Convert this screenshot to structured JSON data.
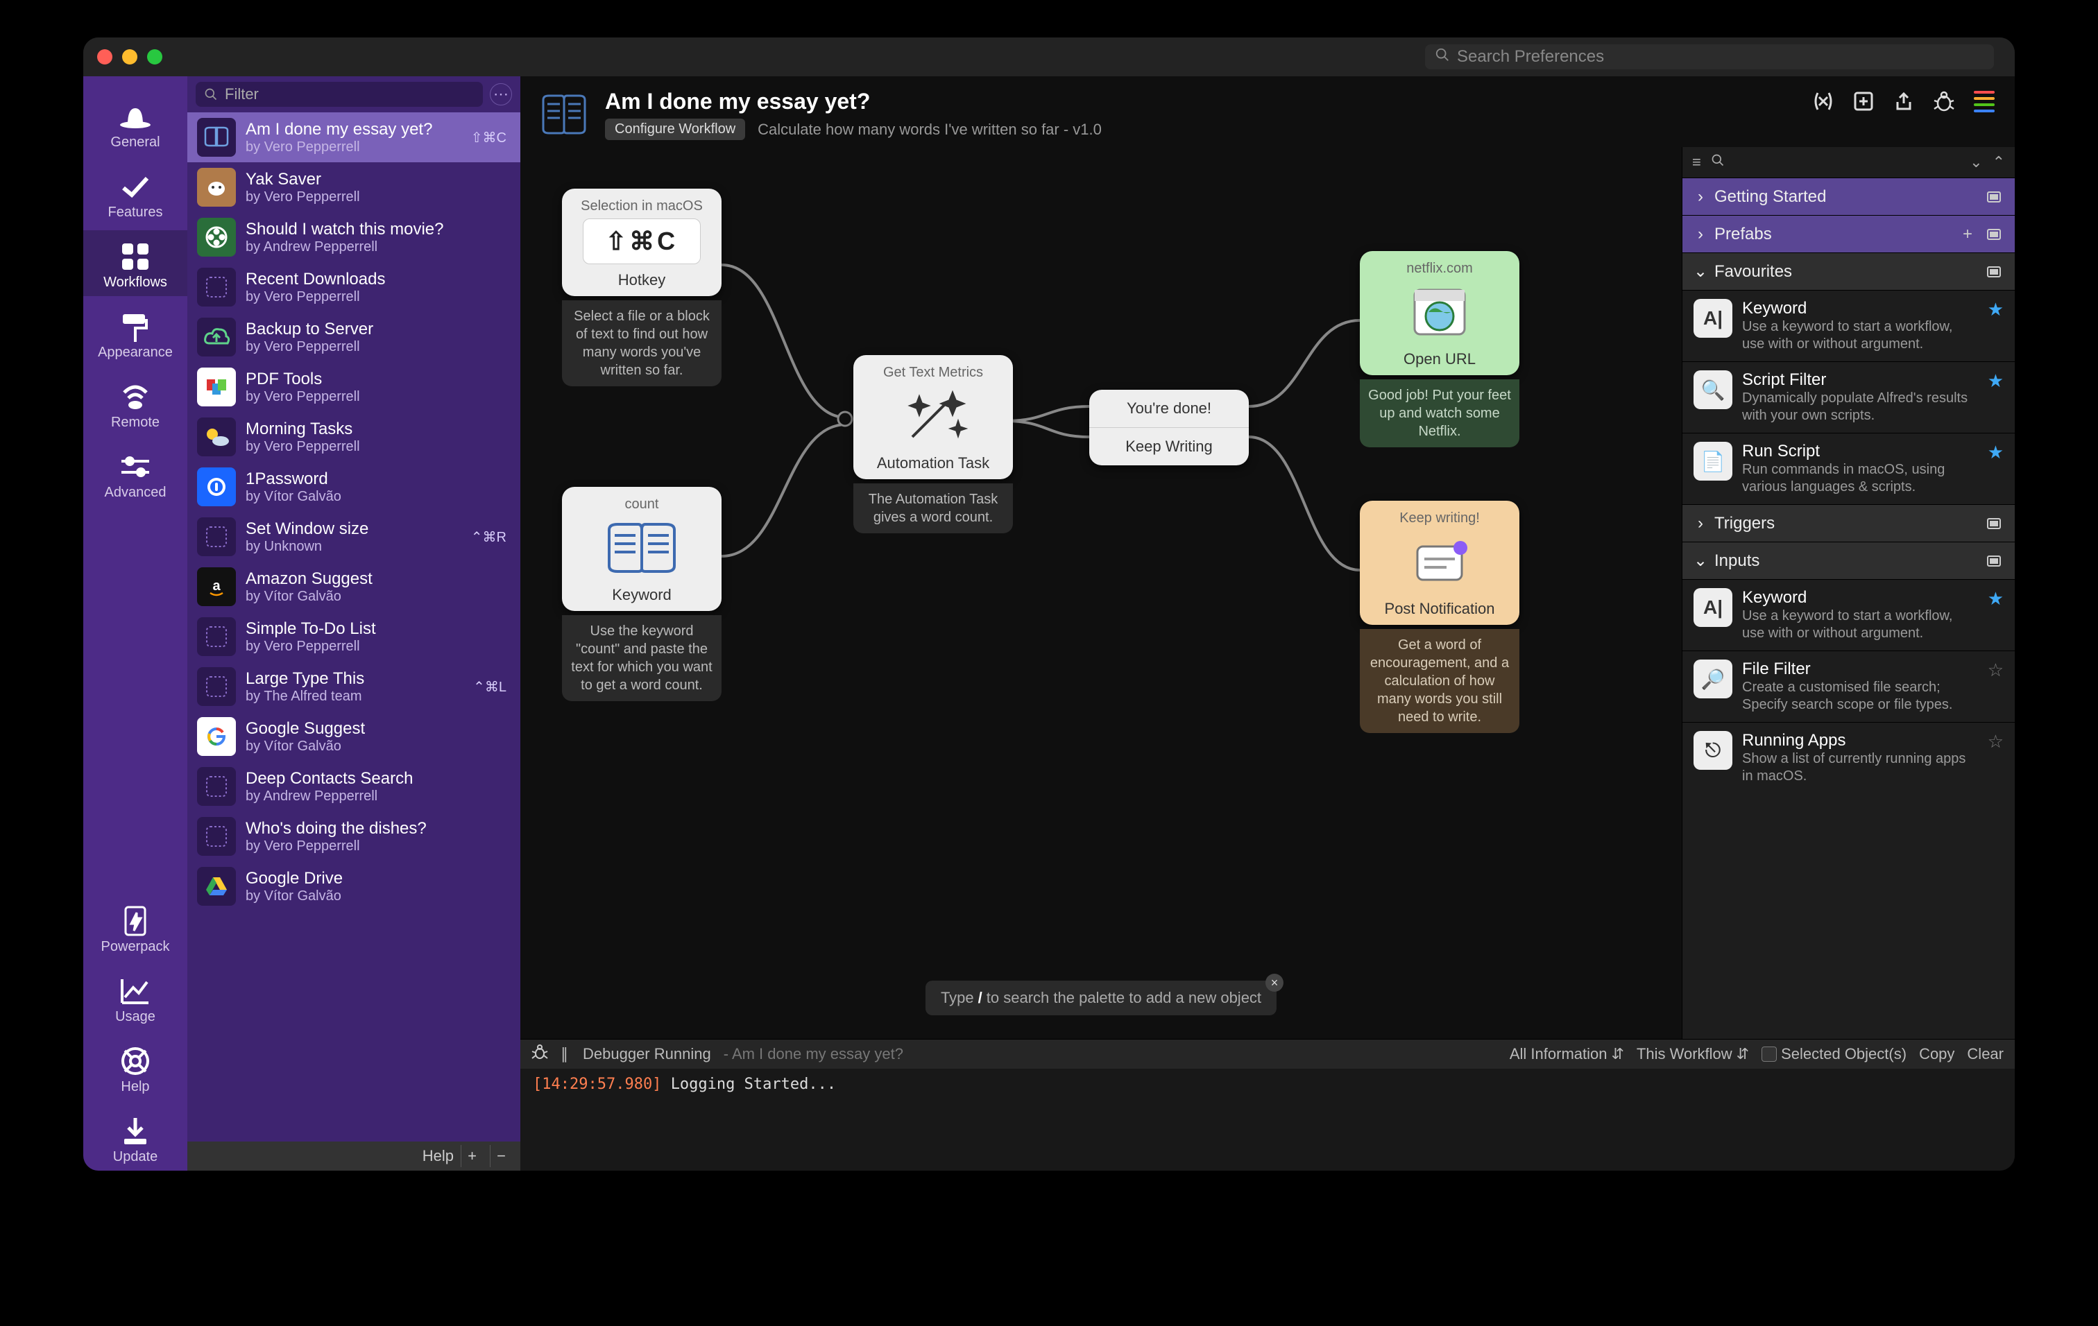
{
  "window": {
    "search_placeholder": "Search Preferences"
  },
  "nav": [
    {
      "id": "general",
      "label": "General",
      "selected": false
    },
    {
      "id": "features",
      "label": "Features",
      "selected": false
    },
    {
      "id": "workflows",
      "label": "Workflows",
      "selected": true
    },
    {
      "id": "appearance",
      "label": "Appearance",
      "selected": false
    },
    {
      "id": "remote",
      "label": "Remote",
      "selected": false
    },
    {
      "id": "advanced",
      "label": "Advanced",
      "selected": false
    }
  ],
  "nav_bottom": [
    {
      "id": "powerpack",
      "label": "Powerpack"
    },
    {
      "id": "usage",
      "label": "Usage"
    },
    {
      "id": "help",
      "label": "Help"
    },
    {
      "id": "update",
      "label": "Update"
    }
  ],
  "wf_filter_placeholder": "Filter",
  "workflows": [
    {
      "title": "Am I done my essay yet?",
      "by": "by Vero Pepperrell",
      "hotkey": "⇧⌘C",
      "selected": true,
      "icon": "book"
    },
    {
      "title": "Yak Saver",
      "by": "by Vero Pepperrell",
      "icon": "cow"
    },
    {
      "title": "Should I watch this movie?",
      "by": "by Andrew Pepperrell",
      "icon": "film"
    },
    {
      "title": "Recent Downloads",
      "by": "by Vero Pepperrell",
      "icon": "placeholder"
    },
    {
      "title": "Backup to Server",
      "by": "by Vero Pepperrell",
      "icon": "cloud-up"
    },
    {
      "title": "PDF Tools",
      "by": "by Vero Pepperrell",
      "icon": "pdf"
    },
    {
      "title": "Morning Tasks",
      "by": "by Vero Pepperrell",
      "icon": "weather"
    },
    {
      "title": "1Password",
      "by": "by Vítor Galvão",
      "icon": "1pwd"
    },
    {
      "title": "Set Window size",
      "by": "by Unknown",
      "hotkey": "⌃⌘R",
      "icon": "placeholder"
    },
    {
      "title": "Amazon Suggest",
      "by": "by Vítor Galvão",
      "icon": "amazon"
    },
    {
      "title": "Simple To-Do List",
      "by": "by Vero Pepperrell",
      "icon": "placeholder"
    },
    {
      "title": "Large Type This",
      "by": "by The Alfred team",
      "hotkey": "⌃⌘L",
      "icon": "placeholder"
    },
    {
      "title": "Google Suggest",
      "by": "by Vítor Galvão",
      "icon": "google"
    },
    {
      "title": "Deep Contacts Search",
      "by": "by Andrew Pepperrell",
      "icon": "placeholder"
    },
    {
      "title": "Who's doing the dishes?",
      "by": "by Vero Pepperrell",
      "icon": "placeholder"
    },
    {
      "title": "Google Drive",
      "by": "by Vítor Galvão",
      "icon": "gdrive"
    }
  ],
  "wf_footer": {
    "help": "Help",
    "plus": "+",
    "minus": "−"
  },
  "header": {
    "title": "Am I done my essay yet?",
    "badge": "Configure Workflow",
    "desc": "Calculate how many words I've written so far - v1.0"
  },
  "palette_sections": [
    {
      "title": "Getting Started",
      "expanded": false,
      "style": "purple",
      "right": [
        "window"
      ]
    },
    {
      "title": "Prefabs",
      "expanded": false,
      "style": "purple",
      "right": [
        "plus",
        "window"
      ]
    },
    {
      "title": "Favourites",
      "expanded": true,
      "style": "dark",
      "right": [
        "window"
      ],
      "items": [
        {
          "name": "Keyword",
          "desc": "Use a keyword to start a workflow, use with or without argument.",
          "icon": "A|",
          "star": true
        },
        {
          "name": "Script Filter",
          "desc": "Dynamically populate Alfred's results with your own scripts.",
          "icon": "🔍",
          "star": true
        },
        {
          "name": "Run Script",
          "desc": "Run commands in macOS, using various languages & scripts.",
          "icon": "📄",
          "star": true
        }
      ]
    },
    {
      "title": "Triggers",
      "expanded": false,
      "style": "dark",
      "right": [
        "window"
      ]
    },
    {
      "title": "Inputs",
      "expanded": true,
      "style": "dark",
      "right": [
        "window"
      ],
      "items": [
        {
          "name": "Keyword",
          "desc": "Use a keyword to start a workflow, use with or without argument.",
          "icon": "A|",
          "star": true
        },
        {
          "name": "File Filter",
          "desc": "Create a customised file search; Specify search scope or file types.",
          "icon": "🔎",
          "star": false
        },
        {
          "name": "Running Apps",
          "desc": "Show a list of currently running apps in macOS.",
          "icon": "⎋",
          "star": false
        }
      ]
    }
  ],
  "canvas": {
    "hotkey": {
      "hat": "Selection in macOS",
      "keys": "⇧⌘C",
      "name": "Hotkey",
      "note": "Select a file or a block of text to find out how many words you've written so far."
    },
    "keyword": {
      "hat": "count",
      "name": "Keyword",
      "note": "Use the keyword \"count\" and paste the text for which you want to get a word count."
    },
    "task": {
      "hat": "Get Text Metrics",
      "name": "Automation Task",
      "note": "The Automation Task gives a word count."
    },
    "cond": {
      "a": "You're done!",
      "b": "Keep Writing"
    },
    "open": {
      "hat": "netflix.com",
      "name": "Open URL",
      "note": "Good job! Put your feet up and watch some Netflix."
    },
    "notif": {
      "hat": "Keep writing!",
      "name": "Post Notification",
      "note": "Get a word of encouragement, and a calculation of how many words you still need to write."
    }
  },
  "palette_hint": {
    "pre": "Type ",
    "key": "/",
    "post": " to search the palette to add a new object"
  },
  "debugger": {
    "status": "Debugger Running",
    "context": "Am I done my essay yet?",
    "level": "All Information",
    "scope": "This Workflow",
    "selected": "Selected Object(s)",
    "copy": "Copy",
    "clear": "Clear",
    "timestamp": "[14:29:57.980]",
    "msg": "Logging Started..."
  }
}
